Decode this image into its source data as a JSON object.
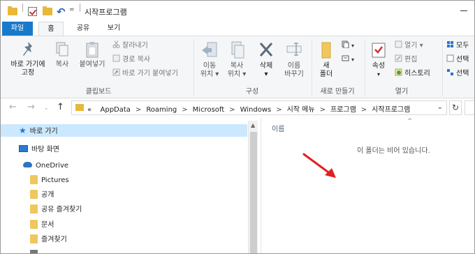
{
  "window": {
    "title": "시작프로그램"
  },
  "tabs": [
    {
      "label": "파일"
    },
    {
      "label": "홈"
    },
    {
      "label": "공유"
    },
    {
      "label": "보기"
    }
  ],
  "ribbon": {
    "clipboard": {
      "pin_label_1": "바로 가기에",
      "pin_label_2": "고정",
      "copy_label": "복사",
      "paste_label": "붙여넣기",
      "cut_label": "잘라내기",
      "copy_path_label": "경로 복사",
      "paste_shortcut_label": "바로 가기 붙여넣기",
      "group_label": "클립보드"
    },
    "organize": {
      "move_label_1": "이동",
      "move_label_2": "위치 ▾",
      "copyto_label_1": "복사",
      "copyto_label_2": "위치 ▾",
      "delete_label_1": "삭제",
      "delete_label_2": "▾",
      "rename_label_1": "이름",
      "rename_label_2": "바꾸기",
      "group_label": "구성"
    },
    "new": {
      "folder_label_1": "새",
      "folder_label_2": "폴더",
      "group_label": "새로 만들기"
    },
    "open": {
      "properties_label": "속성",
      "properties_arrow": "▾",
      "open_label": "열기 ▾",
      "edit_label": "편집",
      "history_label": "히스토리",
      "group_label": "열기"
    },
    "select": {
      "all_label": "모두",
      "none_label": "선택",
      "invert_label": "선택"
    }
  },
  "address": {
    "prefix": "«",
    "crumbs": [
      "AppData",
      "Roaming",
      "Microsoft",
      "Windows",
      "시작 메뉴",
      "프로그램",
      "시작프로그램"
    ],
    "crumb_separator": ">",
    "dropdown": "⌄",
    "refresh": "↻"
  },
  "nav": {
    "quick_access": "바로 가기",
    "desktop": "바탕 화면",
    "onedrive": "OneDrive",
    "folders": [
      "Pictures",
      "공개",
      "공유 즐겨찾기",
      "문서",
      "즐겨찾기"
    ]
  },
  "content": {
    "column_header": "이름",
    "empty_message": "이 폴더는 비어 있습니다."
  },
  "colors": {
    "file_tab": "#1979ca",
    "selection": "#cce8ff",
    "annotation_arrow": "#e02020"
  }
}
